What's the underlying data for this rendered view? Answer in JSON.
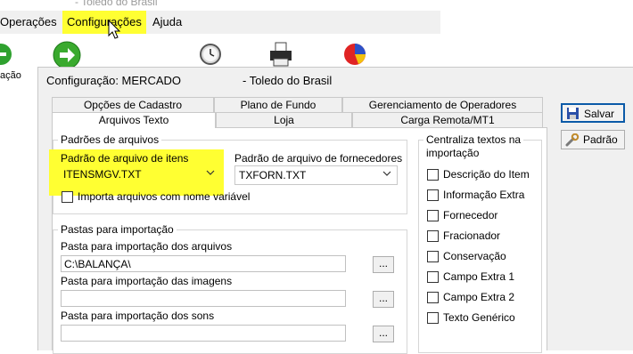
{
  "app": {
    "title_fragment": "Toledo do Brasil",
    "menu": [
      "Operações",
      "Configurações",
      "Ajuda"
    ],
    "left_label": "ação"
  },
  "dialog": {
    "title": "Configuração: MERCADO",
    "title_company": "- Toledo do Brasil",
    "tabs_row1": [
      "Opções de Cadastro",
      "Plano de Fundo",
      "Gerenciamento de Operadores"
    ],
    "tabs_row2": [
      "Arquivos Texto",
      "Loja",
      "Carga Remota/MT1"
    ],
    "active_tab": "Arquivos Texto",
    "buttons": {
      "save": "Salvar",
      "default": "Padrão"
    },
    "padroes": {
      "group_title": "Padrões de arquivos",
      "items_label": "Padrão de arquivo de itens",
      "items_value": "ITENSMGV.TXT",
      "suppliers_label": "Padrão de arquivo de fornecedores",
      "suppliers_value": "TXFORN.TXT",
      "variable_name_label": "Importa arquivos com nome variável"
    },
    "pastas": {
      "group_title": "Pastas para importação",
      "files_label": "Pasta para importação dos arquivos",
      "files_value": "C:\\BALANÇA\\",
      "images_label": "Pasta para importação das imagens",
      "images_value": "",
      "sounds_label": "Pasta para importação dos sons",
      "sounds_value": "",
      "browse": "..."
    },
    "centraliza": {
      "group_title_line1": "Centraliza textos na",
      "group_title_line2": "importação",
      "options": [
        "Descrição do Item",
        "Informação Extra",
        "Fornecedor",
        "Fracionador",
        "Conservação",
        "Campo Extra 1",
        "Campo Extra 2",
        "Texto Genérico"
      ]
    }
  },
  "colors": {
    "highlight": "#ffff32",
    "dialog_bg": "#f0f0f0",
    "default_button_border": "#0b5aa8"
  }
}
